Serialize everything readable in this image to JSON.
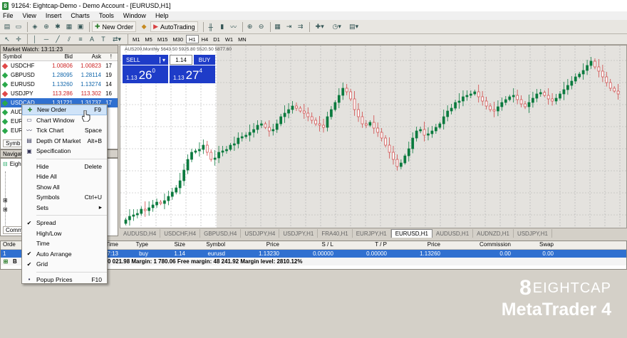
{
  "window": {
    "title": "91264: Eightcap-Demo - Demo Account - [EURUSD,H1]"
  },
  "menu": [
    "File",
    "View",
    "Insert",
    "Charts",
    "Tools",
    "Window",
    "Help"
  ],
  "toolbar": {
    "new_order": "New Order",
    "autotrading": "AutoTrading"
  },
  "timeframes": [
    "M1",
    "M5",
    "M15",
    "M30",
    "H1",
    "H4",
    "D1",
    "W1",
    "MN"
  ],
  "market_watch": {
    "title": "Market Watch: 13:11:23",
    "cols": [
      "Symbol",
      "Bid",
      "Ask",
      "!"
    ],
    "rows": [
      {
        "symbol": "USDCHF",
        "bid": "1.00806",
        "ask": "1.00823",
        "spread": "17",
        "dir": "down"
      },
      {
        "symbol": "GBPUSD",
        "bid": "1.28095",
        "ask": "1.28114",
        "spread": "19",
        "dir": "up"
      },
      {
        "symbol": "EURUSD",
        "bid": "1.13260",
        "ask": "1.13274",
        "spread": "14",
        "dir": "up"
      },
      {
        "symbol": "USDJPY",
        "bid": "113.286",
        "ask": "113.302",
        "spread": "16",
        "dir": "down"
      },
      {
        "symbol": "USDCAD",
        "bid": "1.31721",
        "ask": "1.31737",
        "spread": "17",
        "dir": "sel"
      },
      {
        "symbol": "AUD",
        "bid": "",
        "ask": "",
        "spread": "",
        "dir": "up"
      },
      {
        "symbol": "EUR",
        "bid": "",
        "ask": "",
        "spread": "",
        "dir": "up"
      },
      {
        "symbol": "EUR",
        "bid": "",
        "ask": "",
        "spread": "",
        "dir": "up"
      }
    ],
    "tab": "Symb"
  },
  "navigator": {
    "title": "Navigat",
    "item": "Eigh",
    "tab": "Comm"
  },
  "chart": {
    "label": "AUS200,Monthly  5643.50 5925.80 5520.50 5877.60",
    "sell": "SELL",
    "buy": "BUY",
    "lots": "1.14",
    "sell_price_small": "1.13",
    "sell_price_big": "26",
    "sell_price_sup": "0",
    "buy_price_small": "1.13",
    "buy_price_big": "27",
    "buy_price_sup": "4"
  },
  "chart_tabs": [
    "AUDUSD,H4",
    "USDCHF,H4",
    "GBPUSD,H4",
    "USDJPY,H4",
    "USDJPY,H1",
    "FRA40,H1",
    "EURJPY,H1",
    "EURUSD,H1",
    "AUDUSD,H1",
    "AUDNZD,H1",
    "USDJPY,H1"
  ],
  "active_chart_tab": "EURUSD,H1",
  "terminal": {
    "cols": [
      "Orde",
      "Time",
      "Type",
      "Size",
      "Symbol",
      "Price",
      "S / L",
      "T / P",
      "Price",
      "Commission",
      "Swap"
    ],
    "row": [
      "1",
      "2018.11.16 13:07:13",
      "buy",
      "1.14",
      "eurusd",
      "1.13230",
      "0.00000",
      "0.00000",
      "1.13260",
      "0.00",
      "0.00"
    ],
    "balance_prefix": "B",
    "balance": "0 021.98  Margin: 1 780.06  Free margin: 48 241.92  Margin level: 2810.12%"
  },
  "context_menu": [
    {
      "label": "New Order",
      "shortcut": "F9",
      "icon": "new-order-icon",
      "hl": true
    },
    {
      "label": "Chart Window",
      "shortcut": "",
      "icon": "chart-window-icon"
    },
    {
      "label": "Tick Chart",
      "shortcut": "Space",
      "icon": "tick-chart-icon"
    },
    {
      "label": "Depth Of Market",
      "shortcut": "Alt+B",
      "icon": "depth-icon"
    },
    {
      "label": "Specification",
      "shortcut": "",
      "icon": "spec-icon"
    },
    {
      "sep": true
    },
    {
      "label": "Hide",
      "shortcut": "Delete"
    },
    {
      "label": "Hide All",
      "shortcut": ""
    },
    {
      "label": "Show All",
      "shortcut": ""
    },
    {
      "label": "Symbols",
      "shortcut": "Ctrl+U"
    },
    {
      "label": "Sets",
      "shortcut": "▸"
    },
    {
      "sep": true
    },
    {
      "label": "Spread",
      "shortcut": "",
      "check": true
    },
    {
      "label": "High/Low",
      "shortcut": ""
    },
    {
      "label": "Time",
      "shortcut": ""
    },
    {
      "label": "Auto Arrange",
      "shortcut": "",
      "check": true
    },
    {
      "label": "Grid",
      "shortcut": "",
      "check": true
    },
    {
      "sep": true
    },
    {
      "label": "Popup Prices",
      "shortcut": "F10",
      "icon": "popup-icon"
    }
  ],
  "logo": {
    "brand": "EIGHTCAP",
    "product": "MetaTrader 4"
  }
}
